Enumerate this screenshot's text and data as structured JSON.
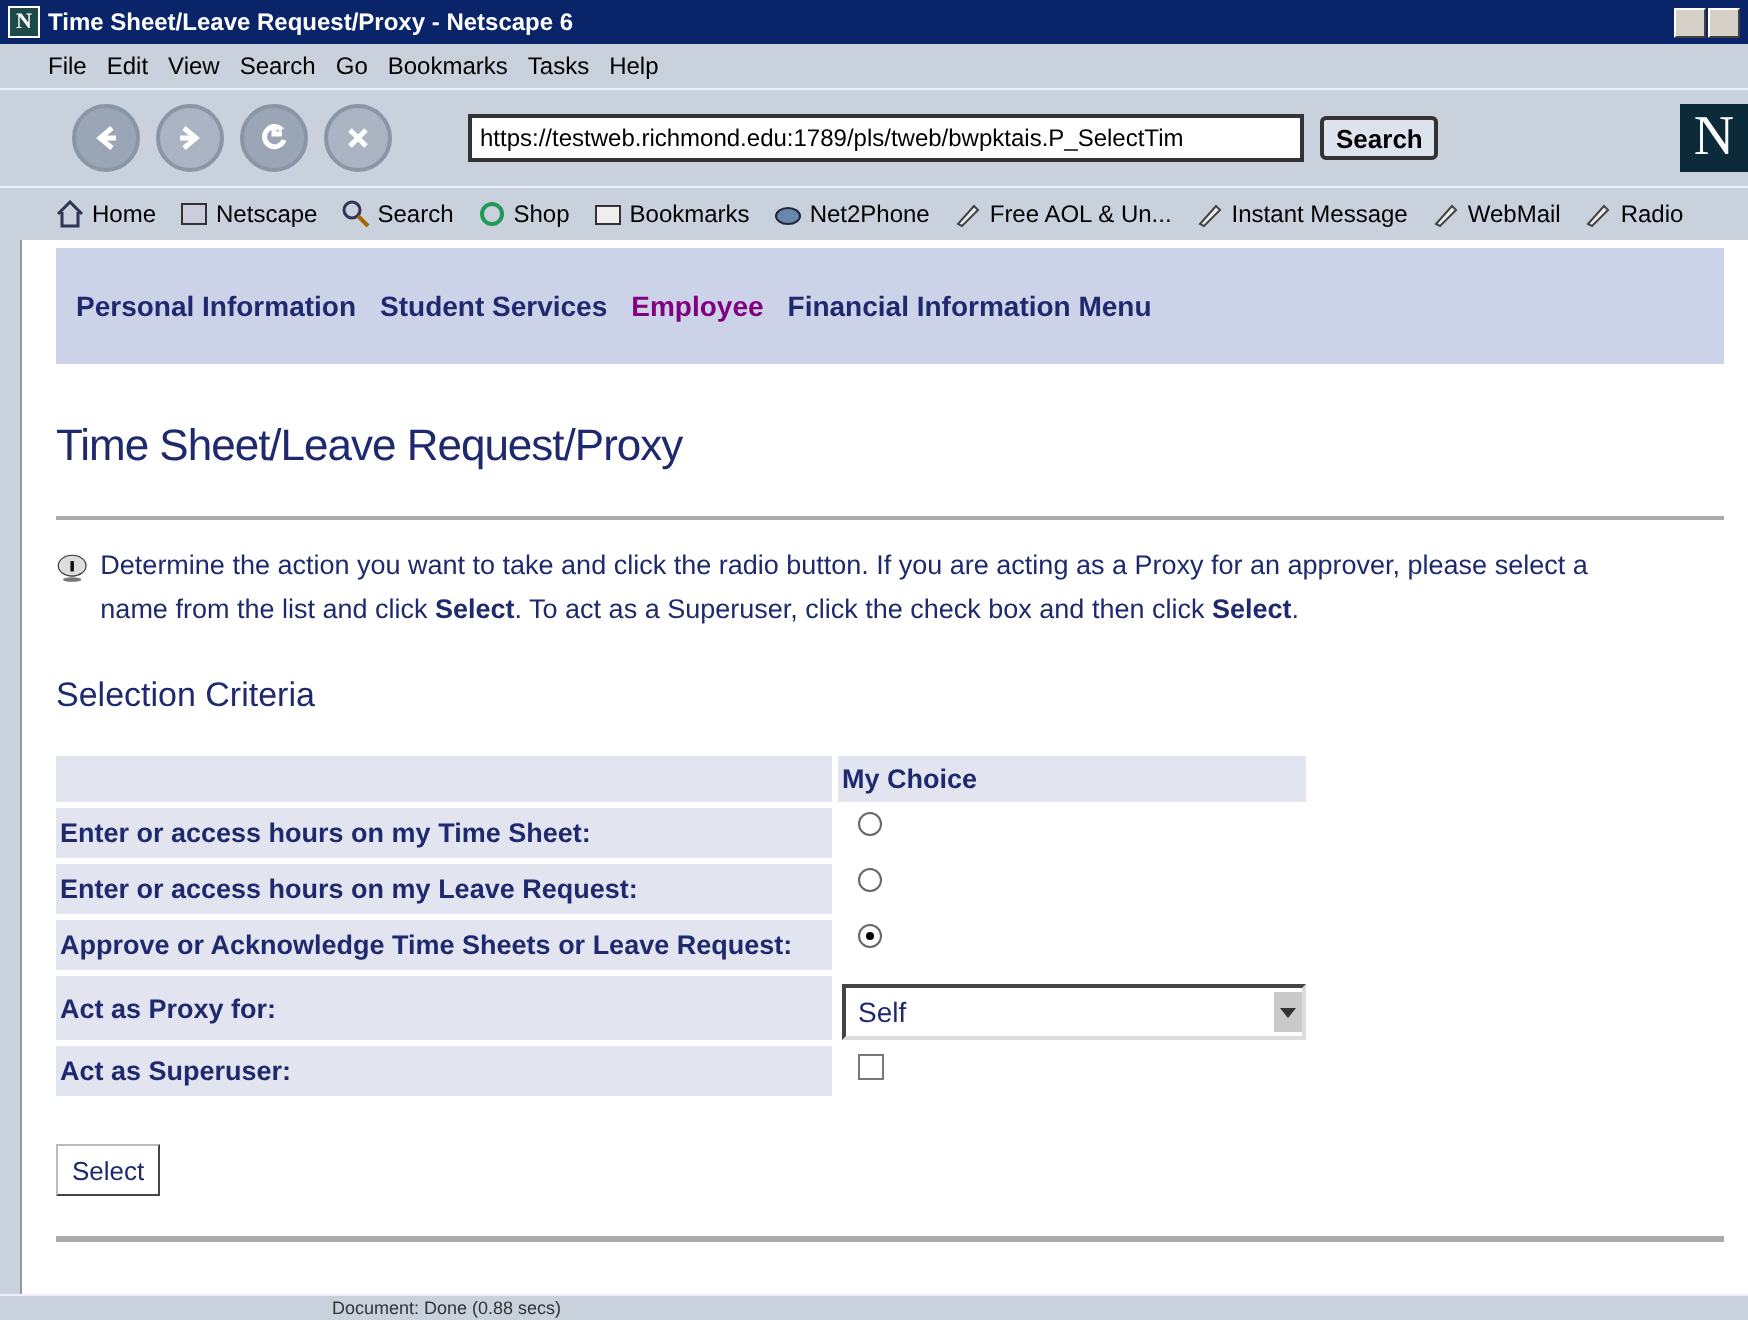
{
  "window": {
    "title": "Time Sheet/Leave Request/Proxy - Netscape 6"
  },
  "menu": [
    "File",
    "Edit",
    "View",
    "Search",
    "Go",
    "Bookmarks",
    "Tasks",
    "Help"
  ],
  "app_icon": "N",
  "toolbar": {
    "url": "https://testweb.richmond.edu:1789/pls/tweb/bwpktais.P_SelectTim",
    "search_button": "Search",
    "logo": "N"
  },
  "personal_bar": [
    {
      "label": "Home",
      "kind": "home"
    },
    {
      "label": "Netscape",
      "kind": "my"
    },
    {
      "label": "Search",
      "kind": "search"
    },
    {
      "label": "Shop",
      "kind": "shop"
    },
    {
      "label": "Bookmarks",
      "kind": "folder"
    },
    {
      "label": "Net2Phone",
      "kind": "phone"
    },
    {
      "label": "Free AOL & Un...",
      "kind": "link"
    },
    {
      "label": "Instant Message",
      "kind": "link"
    },
    {
      "label": "WebMail",
      "kind": "link"
    },
    {
      "label": "Radio",
      "kind": "link"
    }
  ],
  "nav": [
    {
      "label": "Personal Information",
      "selected": false
    },
    {
      "label": "Student Services",
      "selected": false
    },
    {
      "label": "Employee",
      "selected": true
    },
    {
      "label": "Financial Information Menu",
      "selected": false
    }
  ],
  "page_title": "Time Sheet/Leave Request/Proxy",
  "info": "Determine the action you want to take and click the radio button. If you are acting as a Proxy for an approver, please select a name from the list and click **Select**. To act as a Superuser, click the check box and then click **Select**.",
  "section_title": "Selection Criteria",
  "table": {
    "header": "My Choice",
    "rows": [
      {
        "label": "Enter or access hours on my Time Sheet:",
        "kind": "radio",
        "selected": false
      },
      {
        "label": "Enter or access hours on my Leave Request:",
        "kind": "radio",
        "selected": false
      },
      {
        "label": "Approve or Acknowledge Time Sheets or Leave Request:",
        "kind": "radio",
        "selected": true
      },
      {
        "label": "Act as Proxy for:",
        "kind": "select",
        "value": "Self"
      },
      {
        "label": "Act as Superuser:",
        "kind": "checkbox",
        "checked": false
      }
    ]
  },
  "submit": "Select",
  "status_bar": "Document: Done (0.88 secs)"
}
